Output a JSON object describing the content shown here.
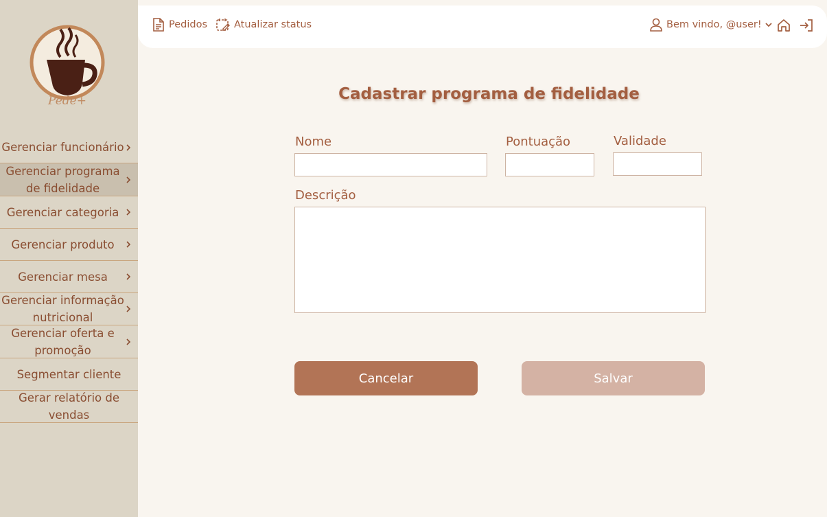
{
  "brand": {
    "name": "Pede+"
  },
  "sidebar": {
    "items": [
      {
        "label": "Gerenciar funcionário",
        "arrow": true,
        "active": false
      },
      {
        "label": "Gerenciar programa de fidelidade",
        "arrow": true,
        "active": true
      },
      {
        "label": "Gerenciar categoria",
        "arrow": true,
        "active": false
      },
      {
        "label": "Gerenciar produto",
        "arrow": true,
        "active": false
      },
      {
        "label": "Gerenciar mesa",
        "arrow": true,
        "active": false
      },
      {
        "label": "Gerenciar informação nutricional",
        "arrow": true,
        "active": false
      },
      {
        "label": "Gerenciar oferta e promoção",
        "arrow": true,
        "active": false
      },
      {
        "label": "Segmentar cliente",
        "arrow": false,
        "active": false
      },
      {
        "label": "Gerar relatório de vendas",
        "arrow": false,
        "active": false
      }
    ]
  },
  "topbar": {
    "orders_label": "Pedidos",
    "update_status_label": "Atualizar status",
    "welcome_label": "Bem vindo, @user!"
  },
  "form": {
    "title": "Cadastrar programa de fidelidade",
    "name_label": "Nome",
    "name_value": "",
    "points_label": "Pontuação",
    "points_value": "",
    "validity_label": "Validade",
    "validity_value": "",
    "description_label": "Descrição",
    "description_value": "",
    "cancel_label": "Cancelar",
    "save_label": "Salvar"
  },
  "colors": {
    "sidebar_bg": "#dcd5c6",
    "sidebar_active_bg": "#c9bfae",
    "page_bg": "#f9f5ef",
    "accent": "#a35e40",
    "cancel_button": "#b27456",
    "save_button_disabled": "#d4b2a4"
  }
}
